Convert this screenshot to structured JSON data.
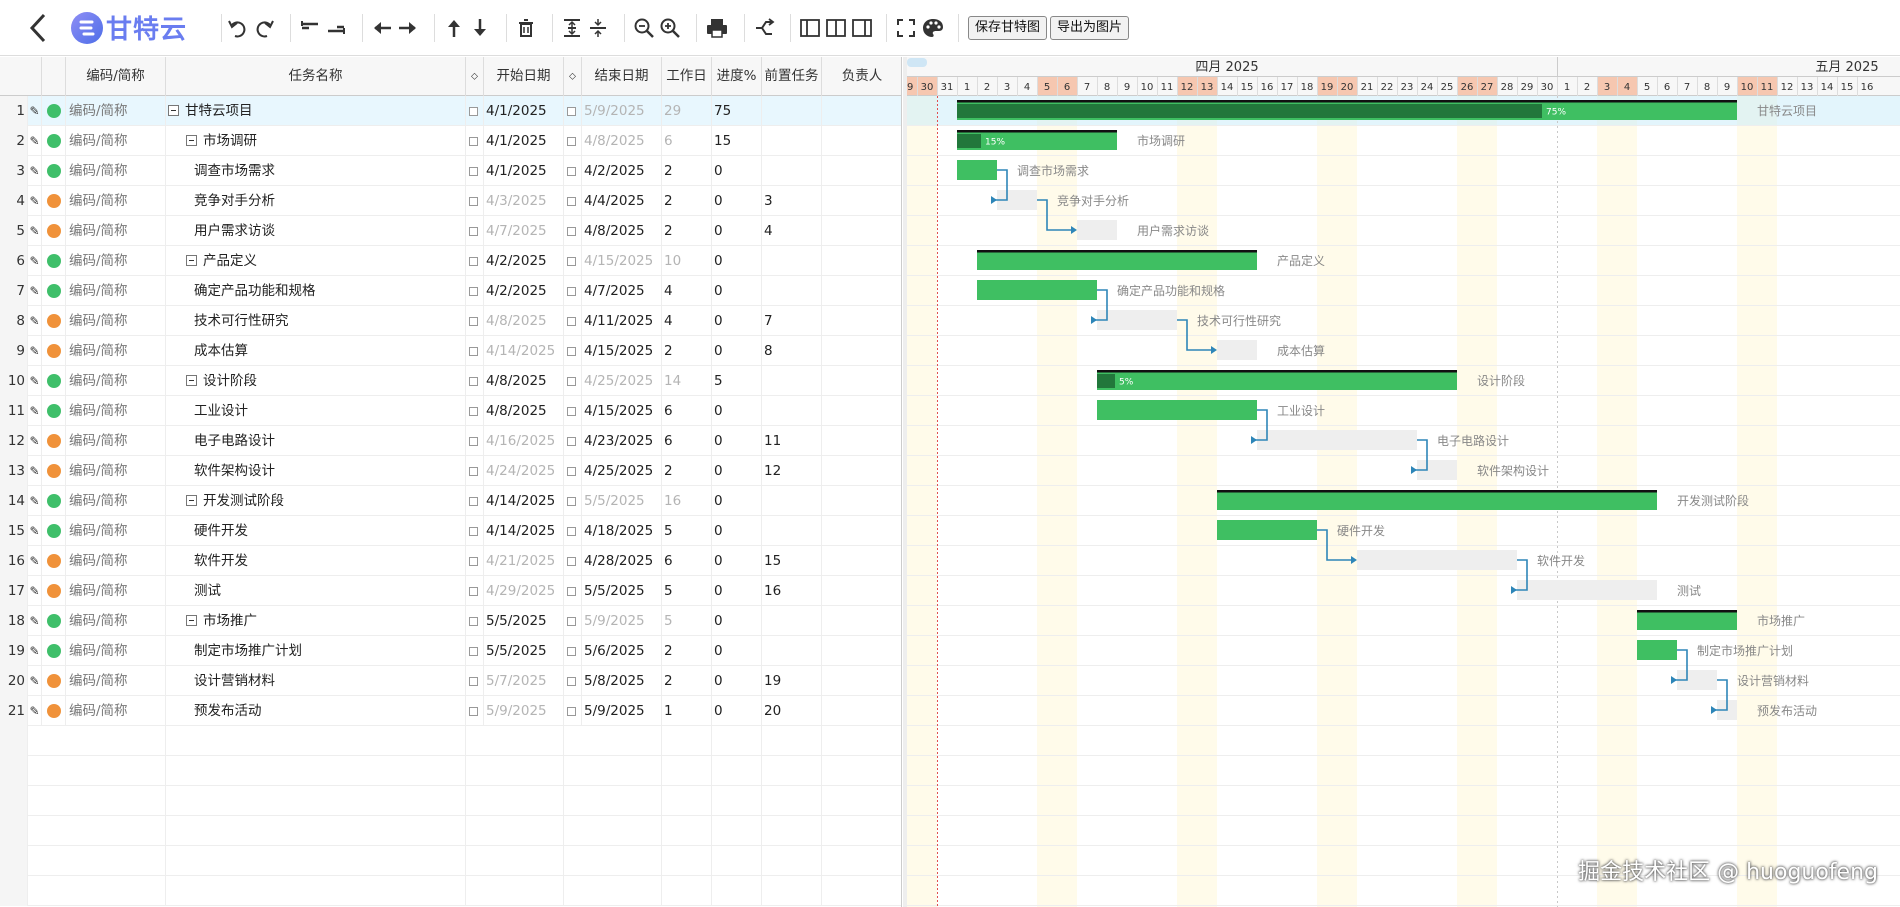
{
  "toolbar": {
    "logo_text": "甘特云",
    "save_button": "保存甘特图",
    "export_button": "导出为图片"
  },
  "grid": {
    "headers": {
      "code": "编码/简称",
      "name": "任务名称",
      "start": "开始日期",
      "end": "结束日期",
      "work": "工作日",
      "progress": "进度%",
      "predecessor": "前置任务",
      "owner": "负责人"
    },
    "rows": [
      {
        "num": "1",
        "code": "编码/简称",
        "name": "甘特云项目",
        "start": "4/1/2025",
        "end": "5/9/2025",
        "work": "29",
        "progress": "75",
        "pred": "",
        "status": "green",
        "level": 0,
        "group": true,
        "start_dim": false,
        "end_dim": true
      },
      {
        "num": "2",
        "code": "编码/简称",
        "name": "市场调研",
        "start": "4/1/2025",
        "end": "4/8/2025",
        "work": "6",
        "progress": "15",
        "pred": "",
        "status": "green",
        "level": 1,
        "group": true,
        "start_dim": false,
        "end_dim": true
      },
      {
        "num": "3",
        "code": "编码/简称",
        "name": "调查市场需求",
        "start": "4/1/2025",
        "end": "4/2/2025",
        "work": "2",
        "progress": "0",
        "pred": "",
        "status": "green",
        "level": 2,
        "group": false,
        "start_dim": false,
        "end_dim": false
      },
      {
        "num": "4",
        "code": "编码/简称",
        "name": "竞争对手分析",
        "start": "4/3/2025",
        "end": "4/4/2025",
        "work": "2",
        "progress": "0",
        "pred": "3",
        "status": "orange",
        "level": 2,
        "group": false,
        "start_dim": true,
        "end_dim": false
      },
      {
        "num": "5",
        "code": "编码/简称",
        "name": "用户需求访谈",
        "start": "4/7/2025",
        "end": "4/8/2025",
        "work": "2",
        "progress": "0",
        "pred": "4",
        "status": "orange",
        "level": 2,
        "group": false,
        "start_dim": true,
        "end_dim": false
      },
      {
        "num": "6",
        "code": "编码/简称",
        "name": "产品定义",
        "start": "4/2/2025",
        "end": "4/15/2025",
        "work": "10",
        "progress": "0",
        "pred": "",
        "status": "green",
        "level": 1,
        "group": true,
        "start_dim": false,
        "end_dim": true
      },
      {
        "num": "7",
        "code": "编码/简称",
        "name": "确定产品功能和规格",
        "start": "4/2/2025",
        "end": "4/7/2025",
        "work": "4",
        "progress": "0",
        "pred": "",
        "status": "green",
        "level": 2,
        "group": false,
        "start_dim": false,
        "end_dim": false
      },
      {
        "num": "8",
        "code": "编码/简称",
        "name": "技术可行性研究",
        "start": "4/8/2025",
        "end": "4/11/2025",
        "work": "4",
        "progress": "0",
        "pred": "7",
        "status": "orange",
        "level": 2,
        "group": false,
        "start_dim": true,
        "end_dim": false
      },
      {
        "num": "9",
        "code": "编码/简称",
        "name": "成本估算",
        "start": "4/14/2025",
        "end": "4/15/2025",
        "work": "2",
        "progress": "0",
        "pred": "8",
        "status": "orange",
        "level": 2,
        "group": false,
        "start_dim": true,
        "end_dim": false
      },
      {
        "num": "10",
        "code": "编码/简称",
        "name": "设计阶段",
        "start": "4/8/2025",
        "end": "4/25/2025",
        "work": "14",
        "progress": "5",
        "pred": "",
        "status": "green",
        "level": 1,
        "group": true,
        "start_dim": false,
        "end_dim": true
      },
      {
        "num": "11",
        "code": "编码/简称",
        "name": "工业设计",
        "start": "4/8/2025",
        "end": "4/15/2025",
        "work": "6",
        "progress": "0",
        "pred": "",
        "status": "green",
        "level": 2,
        "group": false,
        "start_dim": false,
        "end_dim": false
      },
      {
        "num": "12",
        "code": "编码/简称",
        "name": "电子电路设计",
        "start": "4/16/2025",
        "end": "4/23/2025",
        "work": "6",
        "progress": "0",
        "pred": "11",
        "status": "orange",
        "level": 2,
        "group": false,
        "start_dim": true,
        "end_dim": false
      },
      {
        "num": "13",
        "code": "编码/简称",
        "name": "软件架构设计",
        "start": "4/24/2025",
        "end": "4/25/2025",
        "work": "2",
        "progress": "0",
        "pred": "12",
        "status": "orange",
        "level": 2,
        "group": false,
        "start_dim": true,
        "end_dim": false
      },
      {
        "num": "14",
        "code": "编码/简称",
        "name": "开发测试阶段",
        "start": "4/14/2025",
        "end": "5/5/2025",
        "work": "16",
        "progress": "0",
        "pred": "",
        "status": "green",
        "level": 1,
        "group": true,
        "start_dim": false,
        "end_dim": true
      },
      {
        "num": "15",
        "code": "编码/简称",
        "name": "硬件开发",
        "start": "4/14/2025",
        "end": "4/18/2025",
        "work": "5",
        "progress": "0",
        "pred": "",
        "status": "green",
        "level": 2,
        "group": false,
        "start_dim": false,
        "end_dim": false
      },
      {
        "num": "16",
        "code": "编码/简称",
        "name": "软件开发",
        "start": "4/21/2025",
        "end": "4/28/2025",
        "work": "6",
        "progress": "0",
        "pred": "15",
        "status": "orange",
        "level": 2,
        "group": false,
        "start_dim": true,
        "end_dim": false
      },
      {
        "num": "17",
        "code": "编码/简称",
        "name": "测试",
        "start": "4/29/2025",
        "end": "5/5/2025",
        "work": "5",
        "progress": "0",
        "pred": "16",
        "status": "orange",
        "level": 2,
        "group": false,
        "start_dim": true,
        "end_dim": false
      },
      {
        "num": "18",
        "code": "编码/简称",
        "name": "市场推广",
        "start": "5/5/2025",
        "end": "5/9/2025",
        "work": "5",
        "progress": "0",
        "pred": "",
        "status": "green",
        "level": 1,
        "group": true,
        "start_dim": false,
        "end_dim": true
      },
      {
        "num": "19",
        "code": "编码/简称",
        "name": "制定市场推广计划",
        "start": "5/5/2025",
        "end": "5/6/2025",
        "work": "2",
        "progress": "0",
        "pred": "",
        "status": "green",
        "level": 2,
        "group": false,
        "start_dim": false,
        "end_dim": false
      },
      {
        "num": "20",
        "code": "编码/简称",
        "name": "设计营销材料",
        "start": "5/7/2025",
        "end": "5/8/2025",
        "work": "2",
        "progress": "0",
        "pred": "19",
        "status": "orange",
        "level": 2,
        "group": false,
        "start_dim": true,
        "end_dim": false
      },
      {
        "num": "21",
        "code": "编码/简称",
        "name": "预发布活动",
        "start": "5/9/2025",
        "end": "5/9/2025",
        "work": "1",
        "progress": "0",
        "pred": "20",
        "status": "orange",
        "level": 2,
        "group": false,
        "start_dim": true,
        "end_dim": false
      }
    ]
  },
  "gantt": {
    "months": [
      "四月 2025",
      "五月 2025"
    ],
    "bar_progress_labels": [
      "75%",
      "15%",
      "5%"
    ]
  },
  "colors": {
    "green_status": "#3fbf6a",
    "orange_status": "#f0923a",
    "bar_green": "#3fbf62",
    "bar_dark": "#1d6a35",
    "bar_gray": "#eeeeee",
    "link": "#2e86b8",
    "weekend": "#f6c7b0",
    "logo": "#6a7df0"
  },
  "watermark": "掘金技术社区 @ huoguofeng"
}
